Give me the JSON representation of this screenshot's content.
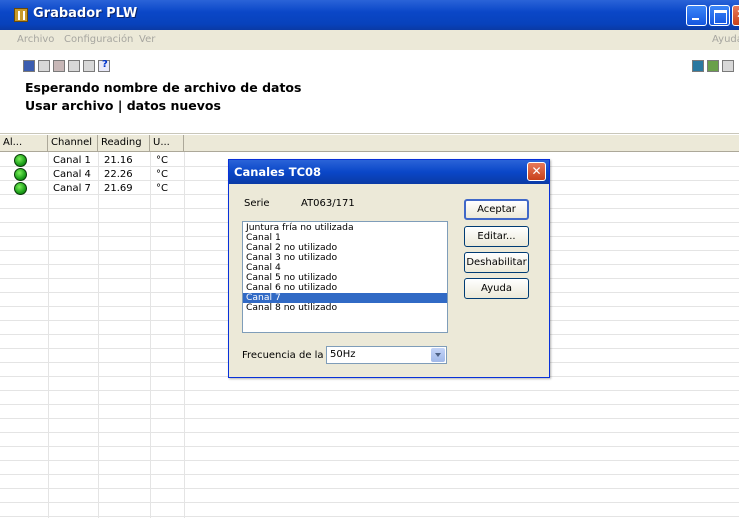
{
  "window": {
    "title": "Grabador PLW"
  },
  "menu": {
    "archivo": "Archivo",
    "configuracion": "Configuración",
    "ver": "Ver",
    "ayuda": "Ayuda"
  },
  "status": {
    "line1": "Esperando nombre de archivo de datos",
    "line2": "Usar archivo | datos nuevos"
  },
  "grid": {
    "headers": {
      "alarm": "Al...",
      "channel": "Channel",
      "reading": "Reading",
      "units": "U..."
    },
    "rows": [
      {
        "channel": "Canal 1",
        "reading": "21.16",
        "units": "°C"
      },
      {
        "channel": "Canal 4",
        "reading": "22.26",
        "units": "°C"
      },
      {
        "channel": "Canal 7",
        "reading": "21.69",
        "units": "°C"
      }
    ]
  },
  "dialog": {
    "title": "Canales TC08",
    "serie_label": "Serie",
    "serie_value": "AT063/171",
    "list": [
      "Juntura fría no utilizada",
      "Canal 1",
      "Canal 2 no utilizado",
      "Canal 3 no utilizado",
      "Canal 4",
      "Canal 5 no utilizado",
      "Canal 6 no utilizado",
      "Canal 7",
      "Canal 8 no utilizado"
    ],
    "selected_index": 7,
    "buttons": {
      "aceptar": "Aceptar",
      "editar": "Editar...",
      "deshabilitar": "Deshabilitar",
      "ayuda": "Ayuda"
    },
    "freq_label": "Frecuencia de la",
    "freq_value": "50Hz"
  },
  "colors": {
    "titlebar": "#0a47c8",
    "selection": "#316ac5",
    "led": "#1ca01a"
  }
}
